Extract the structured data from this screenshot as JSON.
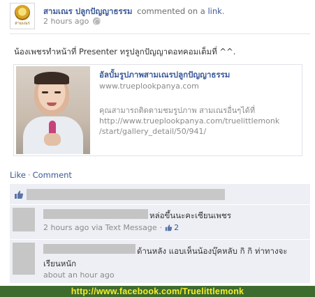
{
  "post": {
    "page_name": "สามเณร ปลูกปัญญาธรรม",
    "action_prefix": "commented on a",
    "action_link": "link",
    "action_suffix": ".",
    "time": "2 hours ago",
    "logo_text": "สามเณร",
    "message": "น้องเพชรทำหน้าที่ Presenter ทรูปลูกปัญญาดอทคอมเต็มที่ ^^."
  },
  "shared_link": {
    "title": "อัลบั้มรูปภาพสามเณรปลูกปัญญาธรรม",
    "domain": "www.trueplookpanya.com",
    "description": "คุณสามารถติดตามชมรูปภาพ สามเณรอื่นๆได้ที่ http://www.trueplookpanya.com/truelittlemonk /start/gallery_detail/50/941/"
  },
  "actions": {
    "like": "Like",
    "separator": "·",
    "comment": "Comment"
  },
  "comments": [
    {
      "text": "หล่อขึ้นนะคะเซียนเพชร",
      "time": "2 hours ago via Text Message",
      "likes": "2"
    },
    {
      "text": "ด้านหลัง แอบเห็นน้องบุ๊คหลับ กิ กิ ท่าทางจะ",
      "text_line2": "เรียนหนัก",
      "time": "about an hour ago"
    }
  ],
  "meta": {
    "dot": "·"
  },
  "watermark": "http://www.facebook.com/Truelittlemonk",
  "colors": {
    "link_blue": "#3b5998",
    "feedback_bg": "#edeff4",
    "watermark_bg": "#3e6c2f",
    "watermark_text": "#f3ee2a"
  }
}
